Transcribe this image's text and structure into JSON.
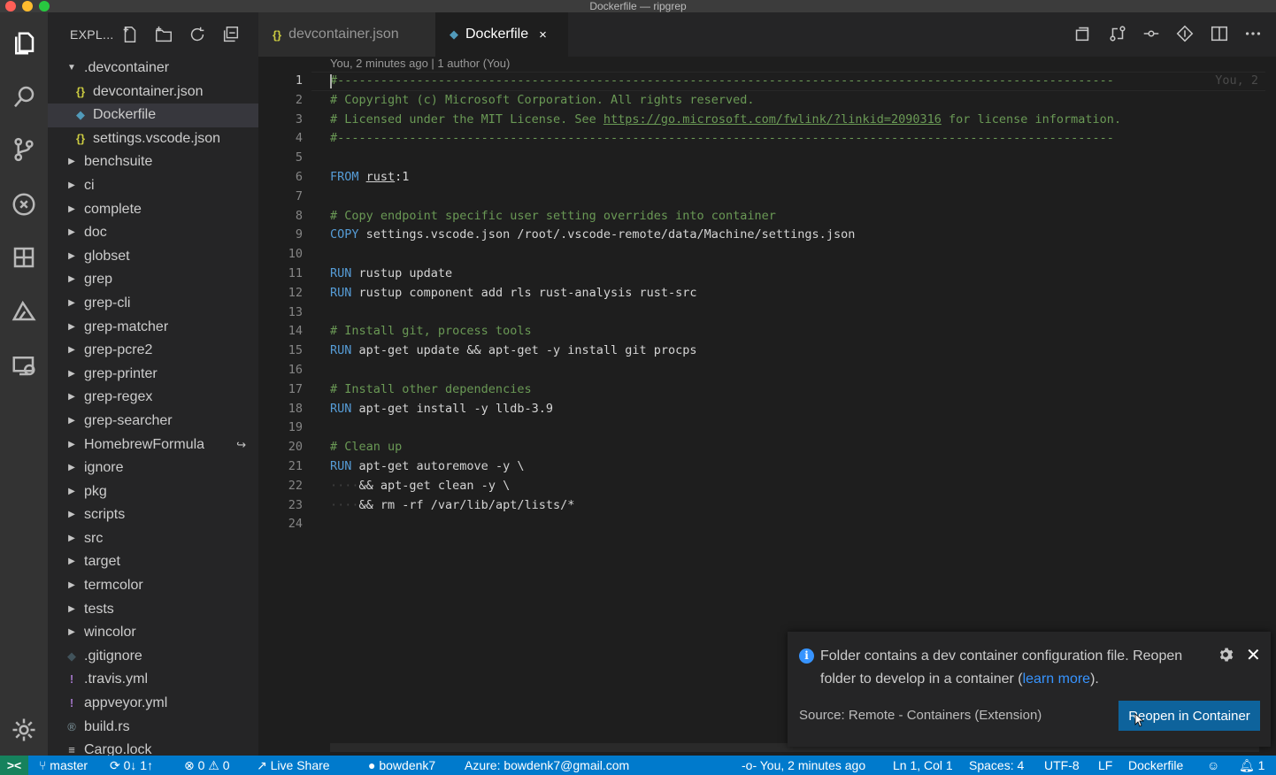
{
  "window": {
    "title": "Dockerfile — ripgrep"
  },
  "colors": {
    "accent": "#007acc",
    "remote": "#16825d",
    "button": "#0e639c",
    "link": "#3794ff",
    "comment": "#6a9955",
    "keyword": "#569cd6"
  },
  "activity_bar": [
    "files-icon",
    "search-icon",
    "source-control-icon",
    "debug-icon",
    "extensions-icon",
    "azure-icon",
    "remote-explorer-icon",
    "settings-gear-icon"
  ],
  "sidebar": {
    "title": "EXPL...",
    "items": [
      {
        "label": ".devcontainer",
        "type": "folder-open",
        "level": 0
      },
      {
        "label": "devcontainer.json",
        "type": "json",
        "level": 1
      },
      {
        "label": "Dockerfile",
        "type": "docker",
        "level": 1,
        "selected": true
      },
      {
        "label": "settings.vscode.json",
        "type": "json",
        "level": 1
      },
      {
        "label": "benchsuite",
        "type": "folder"
      },
      {
        "label": "ci",
        "type": "folder"
      },
      {
        "label": "complete",
        "type": "folder"
      },
      {
        "label": "doc",
        "type": "folder"
      },
      {
        "label": "globset",
        "type": "folder"
      },
      {
        "label": "grep",
        "type": "folder"
      },
      {
        "label": "grep-cli",
        "type": "folder"
      },
      {
        "label": "grep-matcher",
        "type": "folder"
      },
      {
        "label": "grep-pcre2",
        "type": "folder"
      },
      {
        "label": "grep-printer",
        "type": "folder"
      },
      {
        "label": "grep-regex",
        "type": "folder"
      },
      {
        "label": "grep-searcher",
        "type": "folder"
      },
      {
        "label": "HomebrewFormula",
        "type": "folder",
        "symlink": true
      },
      {
        "label": "ignore",
        "type": "folder"
      },
      {
        "label": "pkg",
        "type": "folder"
      },
      {
        "label": "scripts",
        "type": "folder"
      },
      {
        "label": "src",
        "type": "folder"
      },
      {
        "label": "target",
        "type": "folder"
      },
      {
        "label": "termcolor",
        "type": "folder"
      },
      {
        "label": "tests",
        "type": "folder"
      },
      {
        "label": "wincolor",
        "type": "folder"
      },
      {
        "label": ".gitignore",
        "type": "git"
      },
      {
        "label": ".travis.yml",
        "type": "yml"
      },
      {
        "label": "appveyor.yml",
        "type": "yml"
      },
      {
        "label": "build.rs",
        "type": "rust"
      },
      {
        "label": "Cargo.lock",
        "type": "lock"
      }
    ]
  },
  "tabs": [
    {
      "label": "devcontainer.json",
      "active": false
    },
    {
      "label": "Dockerfile",
      "active": true,
      "close": "×"
    }
  ],
  "editor": {
    "blame_header": "You, 2 minutes ago | 1 author (You)",
    "inline_blame": "You, 2",
    "lines": [
      [
        [
          "c",
          "#------------------------------------------------------------------------------------------------------------"
        ]
      ],
      [
        [
          "c",
          "# Copyright (c) Microsoft Corporation. All rights reserved."
        ]
      ],
      [
        [
          "c",
          "# Licensed under the MIT License. See "
        ],
        [
          "l",
          "https://go.microsoft.com/fwlink/?linkid=2090316"
        ],
        [
          "c",
          " for license information."
        ]
      ],
      [
        [
          "c",
          "#------------------------------------------------------------------------------------------------------------"
        ]
      ],
      [],
      [
        [
          "k",
          "FROM "
        ],
        [
          "u",
          "rust"
        ],
        [
          "p",
          ":1"
        ]
      ],
      [],
      [
        [
          "c",
          "# Copy endpoint specific user setting overrides into container"
        ]
      ],
      [
        [
          "k",
          "COPY "
        ],
        [
          "p",
          "settings.vscode.json /root/.vscode-remote/data/Machine/settings.json"
        ]
      ],
      [],
      [
        [
          "k",
          "RUN "
        ],
        [
          "p",
          "rustup update"
        ]
      ],
      [
        [
          "k",
          "RUN "
        ],
        [
          "p",
          "rustup component add rls rust-analysis rust-src"
        ]
      ],
      [],
      [
        [
          "c",
          "# Install git, process tools"
        ]
      ],
      [
        [
          "k",
          "RUN "
        ],
        [
          "p",
          "apt-get update && apt-get -y install git procps"
        ]
      ],
      [],
      [
        [
          "c",
          "# Install other dependencies"
        ]
      ],
      [
        [
          "k",
          "RUN "
        ],
        [
          "p",
          "apt-get install -y lldb-3.9"
        ]
      ],
      [],
      [
        [
          "c",
          "# Clean up"
        ]
      ],
      [
        [
          "k",
          "RUN "
        ],
        [
          "p",
          "apt-get autoremove -y \\"
        ]
      ],
      [
        [
          "w",
          "····"
        ],
        [
          "p",
          "&& apt-get clean -y \\"
        ]
      ],
      [
        [
          "w",
          "····"
        ],
        [
          "p",
          "&& rm -rf /var/lib/apt/lists/*"
        ]
      ],
      []
    ]
  },
  "notification": {
    "message_before": "Folder contains a dev container configuration file. Reopen folder to develop in a container (",
    "link": "learn more",
    "message_after": ").",
    "source": "Source: Remote - Containers (Extension)",
    "button": "Reopen in Container",
    "info_glyph": "i",
    "close_glyph": "✕"
  },
  "statusbar": {
    "remote": "><",
    "branch": "master",
    "sync": "0↓ 1↑",
    "errors": "0",
    "warnings": "0",
    "live_share": "Live Share",
    "github": "bowdenk7",
    "azure": "Azure: bowdenk7@gmail.com",
    "blame": "You, 2 minutes ago",
    "cursor": "Ln 1, Col 1",
    "spaces": "Spaces: 4",
    "encoding": "UTF-8",
    "eol": "LF",
    "language": "Dockerfile",
    "notifications": "1"
  }
}
